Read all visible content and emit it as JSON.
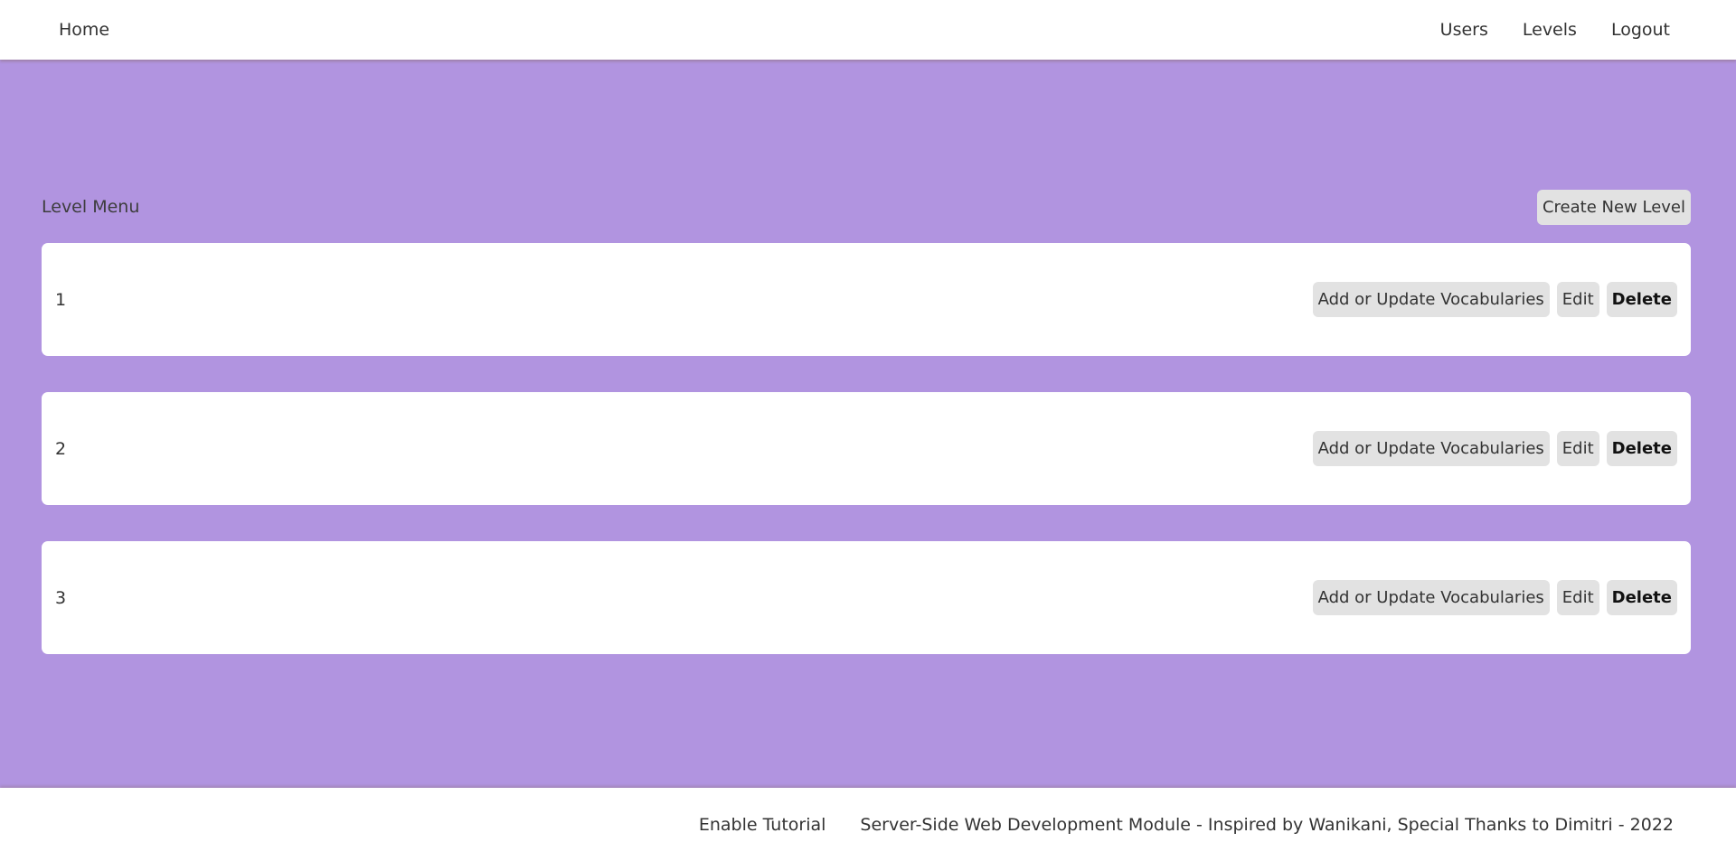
{
  "nav": {
    "home_label": "Home",
    "items": [
      {
        "label": "Users"
      },
      {
        "label": "Levels"
      },
      {
        "label": "Logout"
      }
    ]
  },
  "level_menu": {
    "title": "Level Menu",
    "create_button": "Create New Level",
    "levels": [
      {
        "number": "1",
        "vocab_button": "Add or Update Vocabularies",
        "edit_button": "Edit",
        "delete_button": "Delete"
      },
      {
        "number": "2",
        "vocab_button": "Add or Update Vocabularies",
        "edit_button": "Edit",
        "delete_button": "Delete"
      },
      {
        "number": "3",
        "vocab_button": "Add or Update Vocabularies",
        "edit_button": "Edit",
        "delete_button": "Delete"
      }
    ]
  },
  "footer": {
    "tutorial_link": "Enable Tutorial",
    "credits": "Server-Side Web Development Module - Inspired by Wanikani, Special Thanks to Dimitri - 2022"
  },
  "colors": {
    "background": "#b194e0",
    "surface": "#ffffff",
    "button": "#e2e2e2",
    "text": "#333333"
  }
}
